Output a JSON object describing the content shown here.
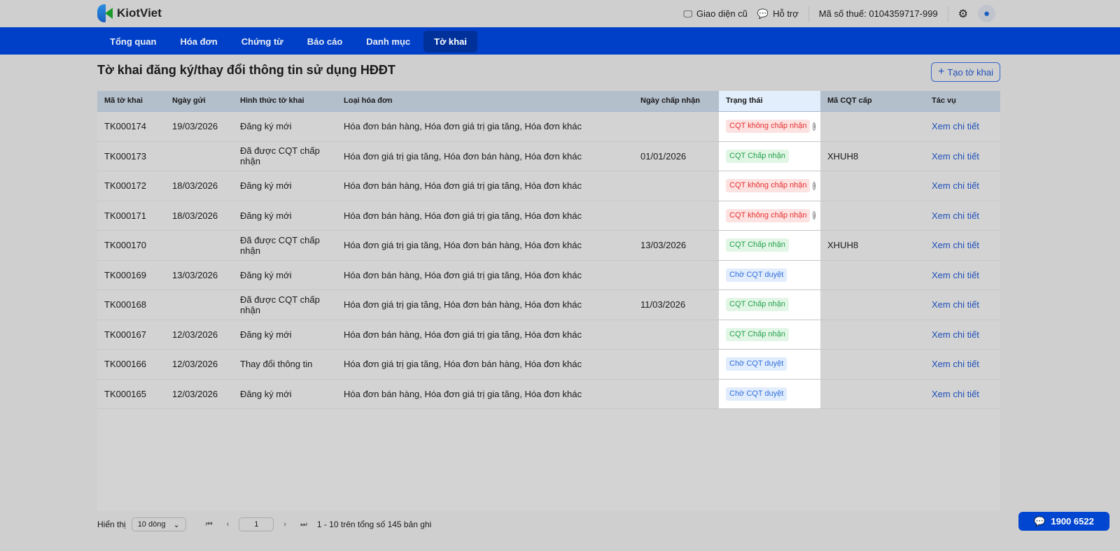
{
  "brand": "KiotViet",
  "top": {
    "old_ui": "Giao diện cũ",
    "support": "Hỗ trợ",
    "tax_code": "Mã số thuế: 0104359717-999"
  },
  "nav": [
    "Tổng quan",
    "Hóa đơn",
    "Chứng từ",
    "Báo cáo",
    "Danh mục",
    "Tờ khai"
  ],
  "nav_active": 5,
  "page_title": "Tờ khai đăng ký/thay đổi thông tin sử dụng HĐĐT",
  "create_label": "Tạo tờ khai",
  "columns": [
    "Mã tờ khai",
    "Ngày gửi",
    "Hình thức tờ khai",
    "Loại hóa đơn",
    "Ngày chấp nhận",
    "Trạng thái",
    "Mã CQT cấp",
    "Tác vụ"
  ],
  "rows": [
    {
      "id": "TK000174",
      "sent": "19/03/2026",
      "form": "Đăng ký mới",
      "types": "Hóa đơn bán hàng, Hóa đơn giá trị gia tăng, Hóa đơn khác",
      "accepted": "",
      "status": "CQT không chấp nhận",
      "kind": "red",
      "code": "",
      "action": "Xem chi tiết"
    },
    {
      "id": "TK000173",
      "sent": "",
      "form": "Đã được CQT chấp nhận",
      "types": "Hóa đơn giá trị gia tăng, Hóa đơn bán hàng, Hóa đơn khác",
      "accepted": "01/01/2026",
      "status": "CQT Chấp nhận",
      "kind": "green",
      "code": "XHUH8",
      "action": "Xem chi tiết"
    },
    {
      "id": "TK000172",
      "sent": "18/03/2026",
      "form": "Đăng ký mới",
      "types": "Hóa đơn bán hàng, Hóa đơn giá trị gia tăng, Hóa đơn khác",
      "accepted": "",
      "status": "CQT không chấp nhận",
      "kind": "red",
      "code": "",
      "action": "Xem chi tiết"
    },
    {
      "id": "TK000171",
      "sent": "18/03/2026",
      "form": "Đăng ký mới",
      "types": "Hóa đơn bán hàng, Hóa đơn giá trị gia tăng, Hóa đơn khác",
      "accepted": "",
      "status": "CQT không chấp nhận",
      "kind": "red",
      "code": "",
      "action": "Xem chi tiết"
    },
    {
      "id": "TK000170",
      "sent": "",
      "form": "Đã được CQT chấp nhận",
      "types": "Hóa đơn giá trị gia tăng, Hóa đơn bán hàng, Hóa đơn khác",
      "accepted": "13/03/2026",
      "status": "CQT Chấp nhận",
      "kind": "green",
      "code": "XHUH8",
      "action": "Xem chi tiết"
    },
    {
      "id": "TK000169",
      "sent": "13/03/2026",
      "form": "Đăng ký mới",
      "types": "Hóa đơn bán hàng, Hóa đơn giá trị gia tăng, Hóa đơn khác",
      "accepted": "",
      "status": "Chờ CQT duyệt",
      "kind": "blue",
      "code": "",
      "action": "Xem chi tiết"
    },
    {
      "id": "TK000168",
      "sent": "",
      "form": "Đã được CQT chấp nhận",
      "types": "Hóa đơn giá trị gia tăng, Hóa đơn bán hàng, Hóa đơn khác",
      "accepted": "11/03/2026",
      "status": "CQT Chấp nhận",
      "kind": "green",
      "code": "",
      "action": "Xem chi tiết"
    },
    {
      "id": "TK000167",
      "sent": "12/03/2026",
      "form": "Đăng ký mới",
      "types": "Hóa đơn bán hàng, Hóa đơn giá trị gia tăng, Hóa đơn khác",
      "accepted": "",
      "status": "CQT Chấp nhận",
      "kind": "green",
      "code": "",
      "action": "Xem chi tiết"
    },
    {
      "id": "TK000166",
      "sent": "12/03/2026",
      "form": "Thay đổi thông tin",
      "types": "Hóa đơn giá trị gia tăng, Hóa đơn bán hàng, Hóa đơn khác",
      "accepted": "",
      "status": "Chờ CQT duyệt",
      "kind": "blue",
      "code": "",
      "action": "Xem chi tiết"
    },
    {
      "id": "TK000165",
      "sent": "12/03/2026",
      "form": "Đăng ký mới",
      "types": "Hóa đơn bán hàng, Hóa đơn giá trị gia tăng, Hóa đơn khác",
      "accepted": "",
      "status": "Chờ CQT duyệt",
      "kind": "blue",
      "code": "",
      "action": "Xem chi tiết"
    }
  ],
  "footer": {
    "show_label": "Hiển thị",
    "page_size": "10 dòng",
    "page": "1",
    "summary": "1 - 10 trên tổng số 145 bản ghi"
  },
  "hotline": "1900 6522"
}
